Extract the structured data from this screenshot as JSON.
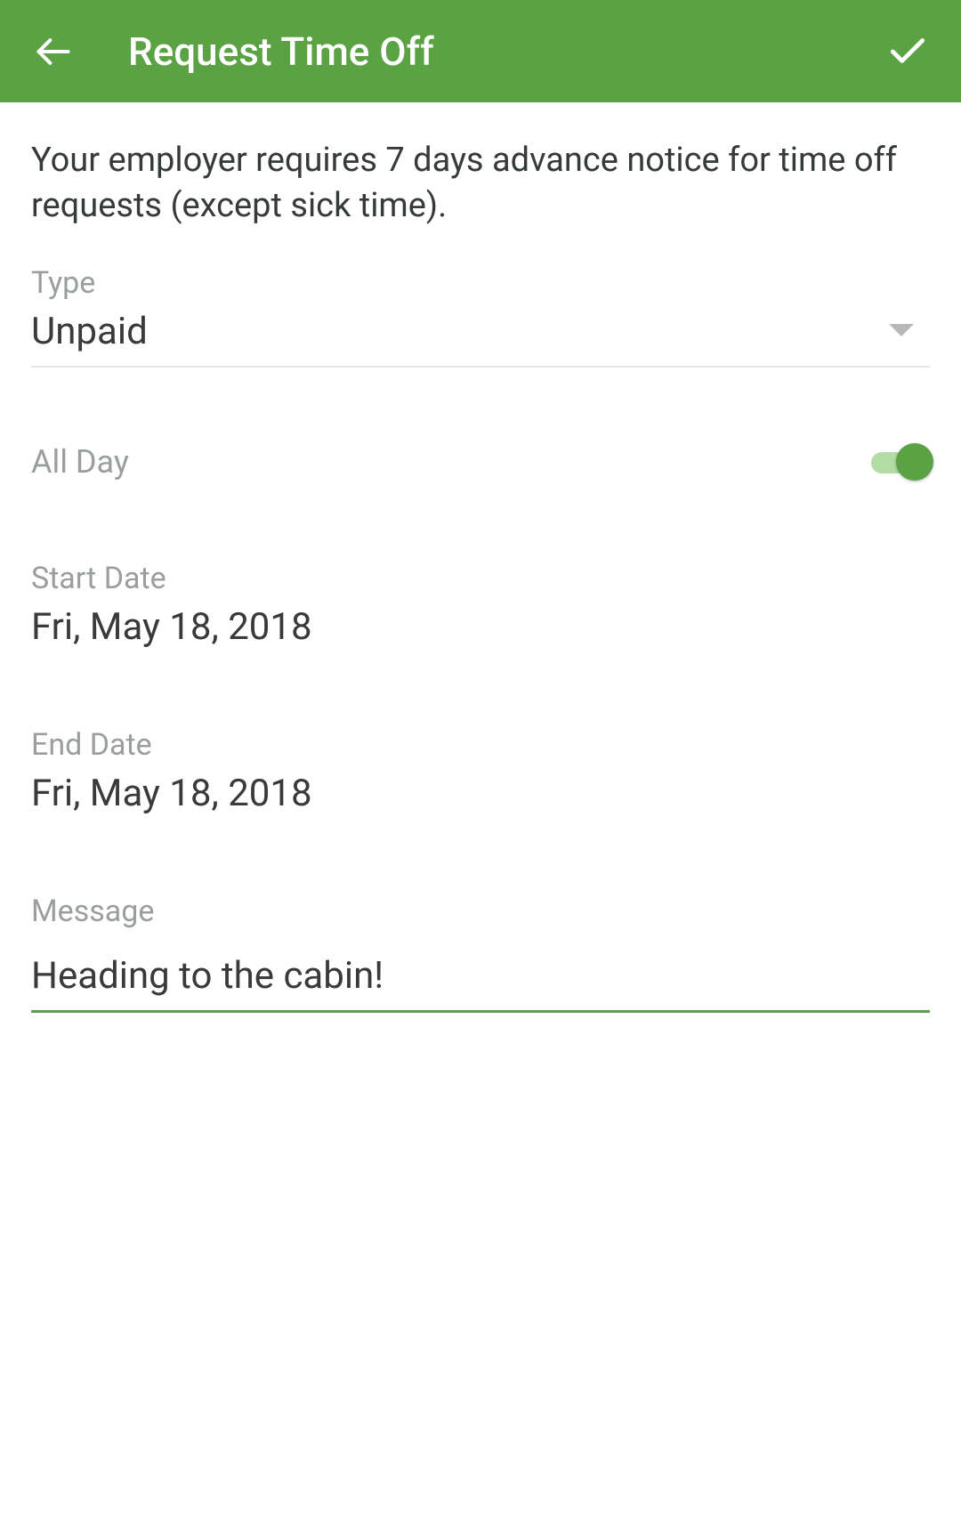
{
  "header": {
    "title": "Request Time Off"
  },
  "notice": "Your employer requires 7 days advance notice for time off requests (except sick time).",
  "type": {
    "label": "Type",
    "value": "Unpaid"
  },
  "allday": {
    "label": "All Day",
    "enabled": true
  },
  "start_date": {
    "label": "Start Date",
    "value": "Fri, May 18, 2018"
  },
  "end_date": {
    "label": "End Date",
    "value": "Fri, May 18, 2018"
  },
  "message": {
    "label": "Message",
    "value": "Heading to the cabin!"
  }
}
